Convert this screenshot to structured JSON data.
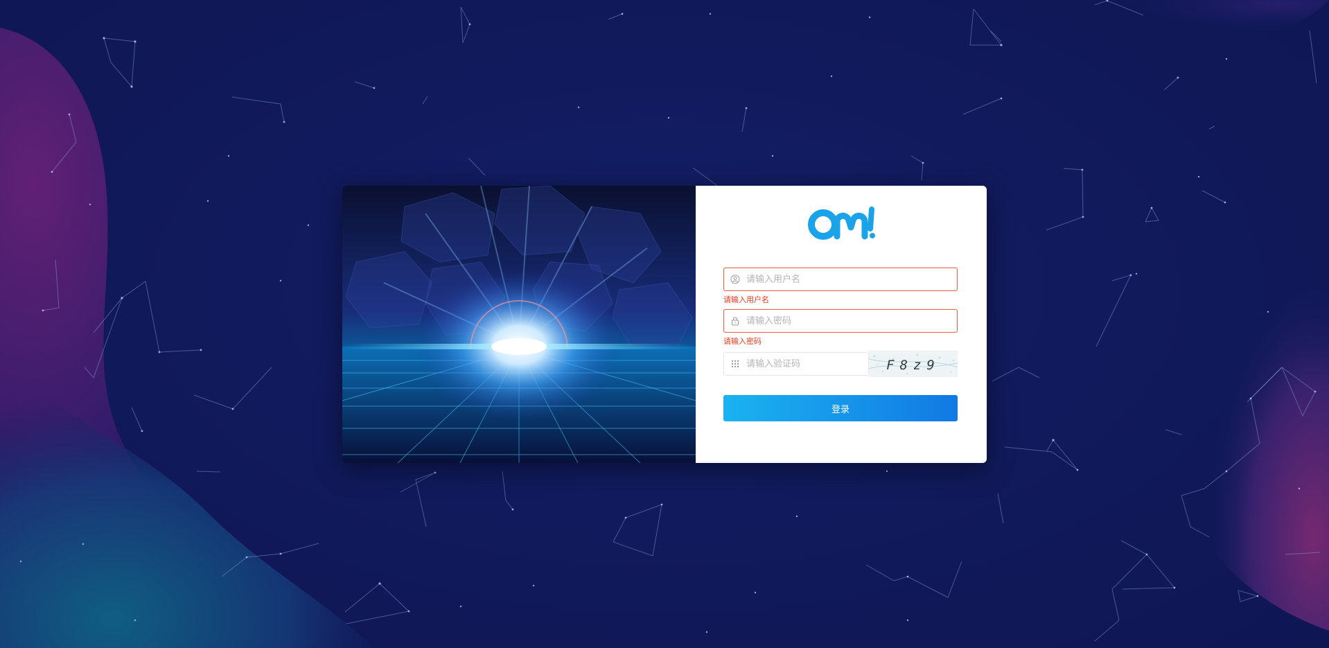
{
  "brand": {
    "logo_text": "OM!",
    "logo_color": "#1aa3e8"
  },
  "login": {
    "username": {
      "placeholder": "请输入用户名",
      "value": "",
      "error": "请输入用户名",
      "icon": "user-icon"
    },
    "password": {
      "placeholder": "请输入密码",
      "value": "",
      "error": "请输入密码",
      "icon": "lock-icon"
    },
    "captcha": {
      "placeholder": "请输入验证码",
      "value": "",
      "icon": "grid-icon",
      "image_text": "F8z9"
    },
    "submit_label": "登录"
  },
  "colors": {
    "error": "#e8381c",
    "button_start": "#1ab3f0",
    "button_end": "#1279e4"
  }
}
